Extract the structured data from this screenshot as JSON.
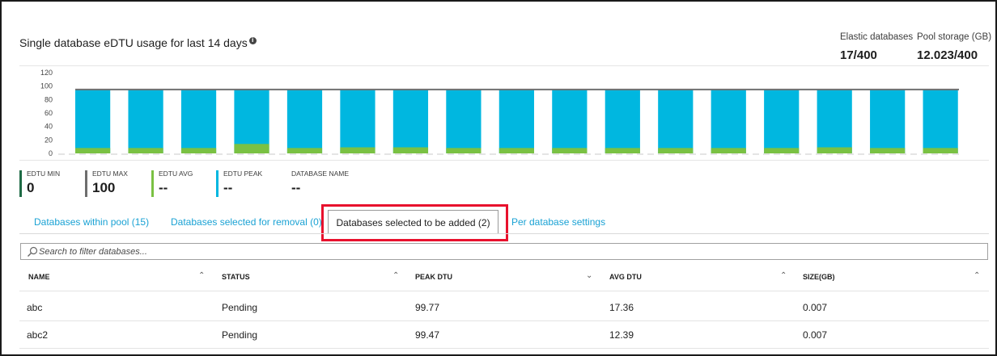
{
  "chart_title": "Single database eDTU usage for last 14 days",
  "stats": {
    "elastic_label": "Elastic databases",
    "elastic_value": "17/400",
    "storage_label": "Pool storage (GB)",
    "storage_value": "12.023/400"
  },
  "chart_data": {
    "type": "bar",
    "title": "Single database eDTU usage for last 14 days",
    "ylim": [
      0,
      120
    ],
    "yticks": [
      0,
      20,
      40,
      60,
      80,
      100,
      120
    ],
    "limit_line": 95,
    "series": [
      {
        "name": "EDTU AVG",
        "values": [
          8,
          8,
          8,
          14,
          8,
          9,
          9,
          8,
          8,
          8,
          8,
          8,
          8,
          8,
          9,
          8,
          8
        ]
      },
      {
        "name": "EDTU PEAK",
        "values": [
          95,
          95,
          95,
          95,
          95,
          95,
          95,
          95,
          95,
          95,
          95,
          95,
          95,
          95,
          95,
          95,
          95
        ]
      }
    ],
    "colors": {
      "avg": "#7ac143",
      "peak": "#00b7e0",
      "max_line": "#707070"
    },
    "grid": false
  },
  "legend": [
    {
      "label": "EDTU MIN",
      "value": "0",
      "color": "#1e6b45"
    },
    {
      "label": "EDTU MAX",
      "value": "100",
      "color": "#6e6e6e"
    },
    {
      "label": "EDTU AVG",
      "value": "--",
      "color": "#7ac143"
    },
    {
      "label": "EDTU PEAK",
      "value": "--",
      "color": "#00b7e0"
    },
    {
      "label": "DATABASE NAME",
      "value": "--",
      "color": ""
    }
  ],
  "tabs": [
    {
      "label": "Databases within pool (15)"
    },
    {
      "label": "Databases selected for removal (0)"
    },
    {
      "label": "Databases selected to be added (2)"
    },
    {
      "label": "Per database settings"
    }
  ],
  "search": {
    "placeholder": "Search to filter databases..."
  },
  "table": {
    "headers": [
      "NAME",
      "STATUS",
      "PEAK DTU",
      "AVG DTU",
      "SIZE(GB)"
    ],
    "sort_icons": [
      "^",
      "^",
      "v",
      "^",
      "^"
    ],
    "rows": [
      [
        "abc",
        "Pending",
        "99.77",
        "17.36",
        "0.007"
      ],
      [
        "abc2",
        "Pending",
        "99.47",
        "12.39",
        "0.007"
      ]
    ]
  }
}
